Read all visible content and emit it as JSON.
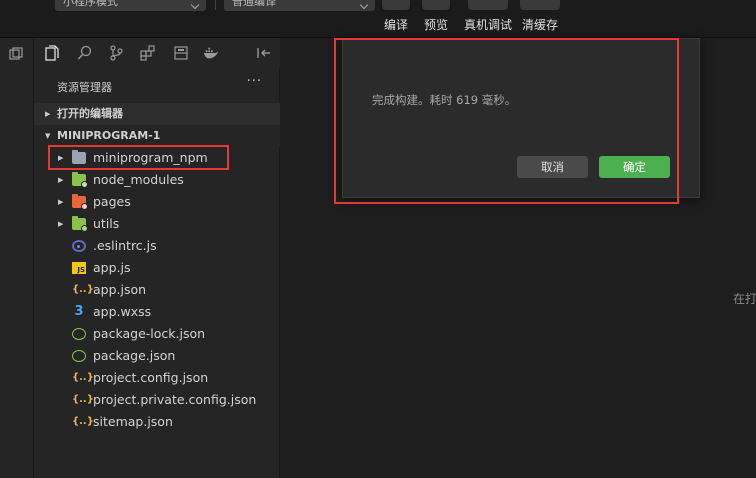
{
  "toolbar": {
    "mode_select": "小程序模式",
    "compile_select": "普通编译",
    "buttons": [
      "编译",
      "预览",
      "真机调试",
      "清缓存"
    ]
  },
  "explorer": {
    "title": "资源管理器",
    "more": "···",
    "open_editors": "打开的编辑器",
    "project": "MINIPROGRAM-1",
    "items": [
      {
        "name": "miniprogram_npm",
        "kind": "folder",
        "icon": "folder-icon"
      },
      {
        "name": "node_modules",
        "kind": "folder",
        "icon": "node-modules-folder-icon"
      },
      {
        "name": "pages",
        "kind": "folder",
        "icon": "pages-folder-icon"
      },
      {
        "name": "utils",
        "kind": "folder",
        "icon": "utils-folder-icon"
      },
      {
        "name": ".eslintrc.js",
        "kind": "file",
        "icon": "eslint-icon"
      },
      {
        "name": "app.js",
        "kind": "file",
        "icon": "js-file-icon"
      },
      {
        "name": "app.json",
        "kind": "file",
        "icon": "json-file-icon"
      },
      {
        "name": "app.wxss",
        "kind": "file",
        "icon": "css-file-icon"
      },
      {
        "name": "package-lock.json",
        "kind": "file",
        "icon": "node-json-icon"
      },
      {
        "name": "package.json",
        "kind": "file",
        "icon": "node-json-icon"
      },
      {
        "name": "project.config.json",
        "kind": "file",
        "icon": "json-file-icon"
      },
      {
        "name": "project.private.config.json",
        "kind": "file",
        "icon": "json-file-icon"
      },
      {
        "name": "sitemap.json",
        "kind": "file",
        "icon": "json-file-icon"
      }
    ]
  },
  "editor": {
    "hint": "在打"
  },
  "dialog": {
    "message": "完成构建。耗时 619 毫秒。",
    "cancel": "取消",
    "ok": "确定"
  },
  "colors": {
    "accent_green": "#4caf50",
    "highlight_red": "#e53935"
  }
}
